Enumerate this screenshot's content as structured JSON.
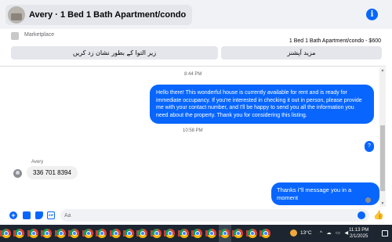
{
  "header": {
    "title": "Avery · 1 Bed 1 Bath Apartment/condo",
    "info_icon": "info-icon"
  },
  "marketplace": {
    "label": "Marketplace",
    "listing": "1 Bed 1 Bath Apartment/condo - $600",
    "button_left": "زیر التوا کے بطور نشان زد کریں",
    "button_right": "مزید آپشنز"
  },
  "messages": {
    "ts1": "8:44 PM",
    "out1": "Hello there! This wonderful house is currently available for rent and is ready for immediate occupancy. If you're interested in checking it out in person, please provide me with your contact number, and I'll be happy to send you all the information you need about the property. Thank you for considering this listing.",
    "ts2": "10:58 PM",
    "out2": "?",
    "sender": "Avery",
    "in1": "336 701 8394",
    "out3": "Thanks i\"ll message you in a moment"
  },
  "composer": {
    "placeholder": "Aa"
  },
  "taskbar": {
    "temperature": "13°C",
    "tray": "^ ☁ ▭ ◀",
    "time": "11:13 PM",
    "date": "2/1/2025",
    "app_count": 20,
    "active_app_index": 16
  },
  "colors": {
    "accent": "#0866ff",
    "bubble_in": "#f0f0f0",
    "taskbar": "#1c2530"
  }
}
